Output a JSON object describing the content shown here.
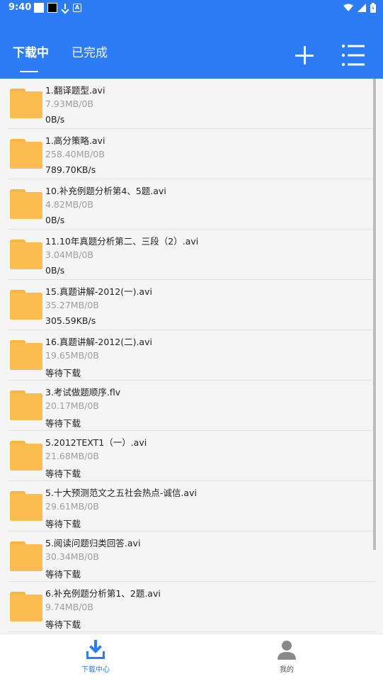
{
  "status_bar": {
    "time": "9:40"
  },
  "tabs": [
    {
      "label": "下载中",
      "active": true
    },
    {
      "label": "已完成",
      "active": false
    }
  ],
  "actions": {
    "add_icon": "plus-icon",
    "menu_icon": "list-icon"
  },
  "downloads": [
    {
      "name": "1.翻译题型.avi",
      "size": "7.93MB/0B",
      "status": "0B/s"
    },
    {
      "name": "1.高分策略.avi",
      "size": "258.40MB/0B",
      "status": "789.70KB/s"
    },
    {
      "name": "10.补充例题分析第4、5题.avi",
      "size": "4.82MB/0B",
      "status": "0B/s"
    },
    {
      "name": "11.10年真题分析第二、三段（2）.avi",
      "size": "3.04MB/0B",
      "status": "0B/s"
    },
    {
      "name": "15.真题讲解-2012(一).avi",
      "size": "35.27MB/0B",
      "status": "305.59KB/s"
    },
    {
      "name": "16.真题讲解-2012(二).avi",
      "size": "19.65MB/0B",
      "status": "等待下载"
    },
    {
      "name": "3.考试做题顺序.flv",
      "size": "20.17MB/0B",
      "status": "等待下载"
    },
    {
      "name": "5.2012TEXT1（一）.avi",
      "size": "21.68MB/0B",
      "status": "等待下载"
    },
    {
      "name": "5.十大预测范文之五社会热点-诚信.avi",
      "size": "29.61MB/0B",
      "status": "等待下载"
    },
    {
      "name": "5.阅读问题归类回答.avi",
      "size": "30.34MB/0B",
      "status": "等待下载"
    },
    {
      "name": "6.补充例题分析第1、2题.avi",
      "size": "9.74MB/0B",
      "status": "等待下载"
    }
  ],
  "bottom_nav": [
    {
      "label": "下载中心",
      "icon": "download-icon",
      "active": true
    },
    {
      "label": "我的",
      "icon": "person-icon",
      "active": false
    }
  ],
  "colors": {
    "primary": "#2b7cf5",
    "folder": "#fbbd4f",
    "background": "#f5f5f5"
  }
}
